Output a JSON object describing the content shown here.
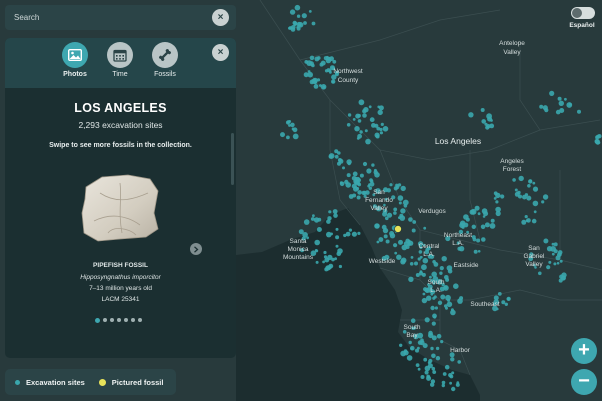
{
  "search": {
    "placeholder": "Search",
    "clear_label": "×"
  },
  "panel": {
    "close_label": "×",
    "tabs": [
      {
        "label": "Photos",
        "icon": "photo-icon",
        "active": true
      },
      {
        "label": "Time",
        "icon": "calendar-icon",
        "active": false
      },
      {
        "label": "Fossils",
        "icon": "bone-icon",
        "active": false
      }
    ],
    "title": "LOS ANGELES",
    "count": "2,293 excavation sites",
    "hint": "Swipe to see more fossils in the collection.",
    "fossil": {
      "name": "PIPEFISH FOSSIL",
      "species": "Hipposyngnathus imporcitor",
      "age": "7–13 million years old",
      "catalog": "LACM 25341"
    },
    "carousel": {
      "total": 7,
      "current": 1
    }
  },
  "legend": {
    "items": [
      {
        "label": "Excavation sites",
        "color": "#3aa7ad"
      },
      {
        "label": "Pictured fossil",
        "color": "#e8e35a"
      }
    ]
  },
  "language_toggle": {
    "label": "Español",
    "on": false
  },
  "zoom": {
    "in_label": "+",
    "out_label": "−"
  },
  "map": {
    "labels": [
      {
        "text": "Antelope"
      },
      {
        "text": "Valley"
      },
      {
        "text": "Northwest"
      },
      {
        "text": "County"
      },
      {
        "text": "Los Angeles"
      },
      {
        "text": "Angeles"
      },
      {
        "text": "Forest"
      },
      {
        "text": "San"
      },
      {
        "text": "Fernando"
      },
      {
        "text": "Valley"
      },
      {
        "text": "Verdugos"
      },
      {
        "text": "Santa"
      },
      {
        "text": "Monica"
      },
      {
        "text": "Mountains"
      },
      {
        "text": "Westside"
      },
      {
        "text": "Central"
      },
      {
        "text": "L.A."
      },
      {
        "text": "Northeast"
      },
      {
        "text": "L.A."
      },
      {
        "text": "Eastside"
      },
      {
        "text": "San"
      },
      {
        "text": "Gabriel"
      },
      {
        "text": "Valley"
      },
      {
        "text": "South"
      },
      {
        "text": "L.A."
      },
      {
        "text": "Southeast"
      },
      {
        "text": "South"
      },
      {
        "text": "Bay"
      },
      {
        "text": "Harbor"
      }
    ],
    "colors": {
      "land": "#2a3b3d",
      "ocean": "#1d2e30",
      "sites": "#3aa7ad",
      "highlight": "#e8e35a"
    }
  }
}
